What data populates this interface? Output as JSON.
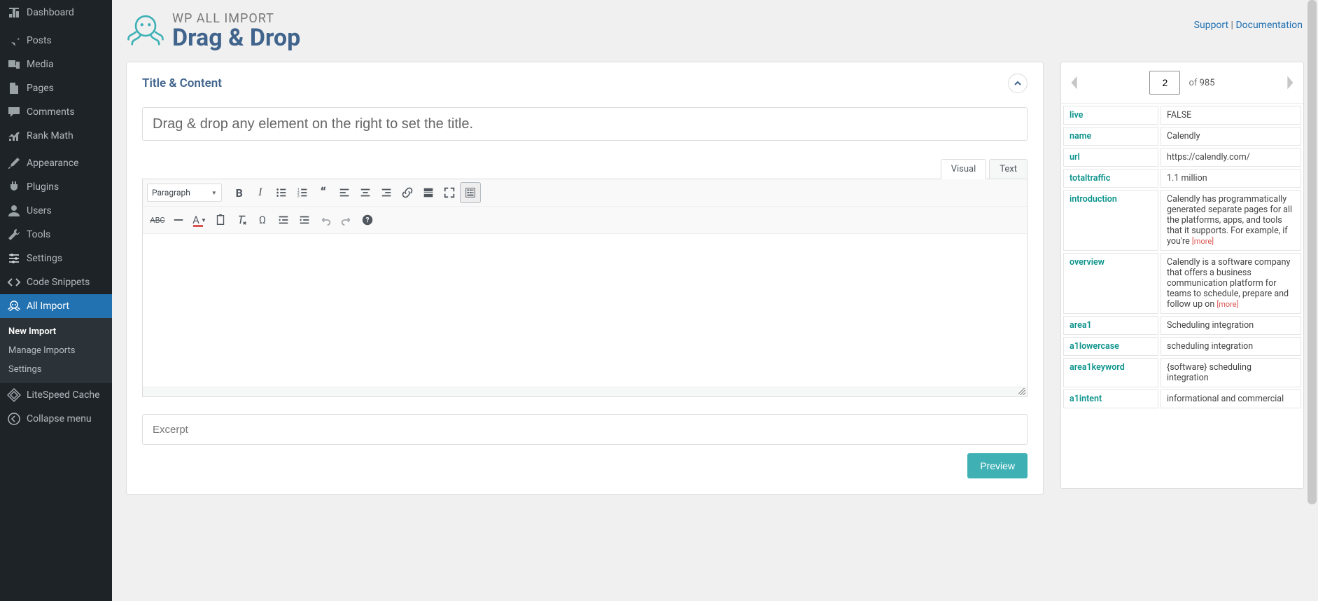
{
  "sidebar": {
    "items": [
      {
        "label": "Dashboard",
        "icon": "dashboard"
      },
      {
        "label": "Posts",
        "icon": "pin"
      },
      {
        "label": "Media",
        "icon": "media"
      },
      {
        "label": "Pages",
        "icon": "page"
      },
      {
        "label": "Comments",
        "icon": "comment"
      },
      {
        "label": "Rank Math",
        "icon": "chart"
      },
      {
        "label": "Appearance",
        "icon": "brush"
      },
      {
        "label": "Plugins",
        "icon": "plug"
      },
      {
        "label": "Users",
        "icon": "user"
      },
      {
        "label": "Tools",
        "icon": "wrench"
      },
      {
        "label": "Settings",
        "icon": "sliders"
      },
      {
        "label": "Code Snippets",
        "icon": "code"
      },
      {
        "label": "All Import",
        "icon": "octopus"
      },
      {
        "label": "LiteSpeed Cache",
        "icon": "litespeed"
      },
      {
        "label": "Collapse menu",
        "icon": "collapse"
      }
    ],
    "submenu": [
      {
        "label": "New Import",
        "current": true
      },
      {
        "label": "Manage Imports"
      },
      {
        "label": "Settings"
      }
    ]
  },
  "header": {
    "brand": "WP ALL IMPORT",
    "title": "Drag & Drop",
    "support": "Support",
    "separator": " | ",
    "documentation": "Documentation"
  },
  "panel": {
    "title": "Title & Content",
    "title_placeholder": "Drag & drop any element on the right to set the title.",
    "excerpt_placeholder": "Excerpt",
    "preview_label": "Preview",
    "tabs": {
      "visual": "Visual",
      "text": "Text"
    },
    "format_select": "Paragraph"
  },
  "browser": {
    "page": "2",
    "of_label": "of",
    "total": "985",
    "more_label": "[more]",
    "rows": [
      {
        "k": "live",
        "v": "FALSE"
      },
      {
        "k": "name",
        "v": "Calendly"
      },
      {
        "k": "url",
        "v": "https://calendly.com/"
      },
      {
        "k": "totaltraffic",
        "v": "1.1 million"
      },
      {
        "k": "introduction",
        "v": "Calendly has programmatically generated separate pages for all the platforms, apps, and tools that it supports. For example, if you're ",
        "more": true
      },
      {
        "k": "overview",
        "v": "Calendly is a software company that offers a business communication platform for teams to schedule, prepare and follow up on ",
        "more": true
      },
      {
        "k": "area1",
        "v": "Scheduling integration"
      },
      {
        "k": "a1lowercase",
        "v": "scheduling integration"
      },
      {
        "k": "area1keyword",
        "v": "{software} scheduling integration"
      },
      {
        "k": "a1intent",
        "v": "informational and commercial"
      }
    ]
  }
}
